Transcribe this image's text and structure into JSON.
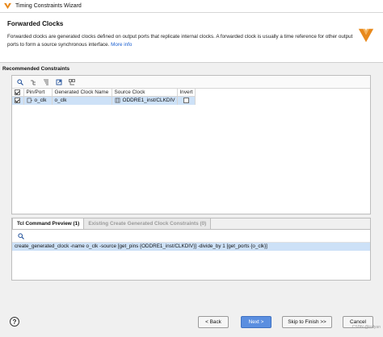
{
  "window": {
    "title": "Timing Constraints Wizard",
    "app_icon": "vivado-logo-icon"
  },
  "header": {
    "title": "Forwarded Clocks",
    "description": "Forwarded clocks are generated clocks defined on output ports that replicate internal clocks. A forwarded clock is usually a time reference for other output ports to form a source synchronous interface.",
    "more_info_link": "More info",
    "logo": "vivado-logo"
  },
  "recommended": {
    "section_label": "Recommended Constraints",
    "toolbar_icons": [
      "search-icon",
      "collapse-icon",
      "expand-icon",
      "export-icon",
      "group-icon"
    ],
    "columns": [
      "",
      "Pin/Port",
      "Generated Clock Name",
      "Source Clock",
      "Invert"
    ],
    "rows": [
      {
        "selected": true,
        "pin_port": "o_clk",
        "generated_clock_name": "o_clk",
        "source_clock": "ODDRE1_inst/CLKDIV",
        "invert": false
      }
    ]
  },
  "tcl_panel": {
    "tabs": [
      "Tcl Command Preview (1)",
      "Existing Create Generated Clock Constraints (0)"
    ],
    "active_tab": 0,
    "command": "create_generated_clock -name o_clk -source [get_pins {ODDRE1_inst/CLKDIV}] -divide_by 1 [get_ports {o_clk}]"
  },
  "footer": {
    "help": "?",
    "back": "< Back",
    "next": "Next >",
    "skip": "Skip to Finish >>",
    "cancel": "Cancel"
  },
  "watermark": "CSDN @tcdyan",
  "colors": {
    "accent": "#5b8fe0",
    "selection": "#cde1f7",
    "link": "#1a5fd0"
  }
}
